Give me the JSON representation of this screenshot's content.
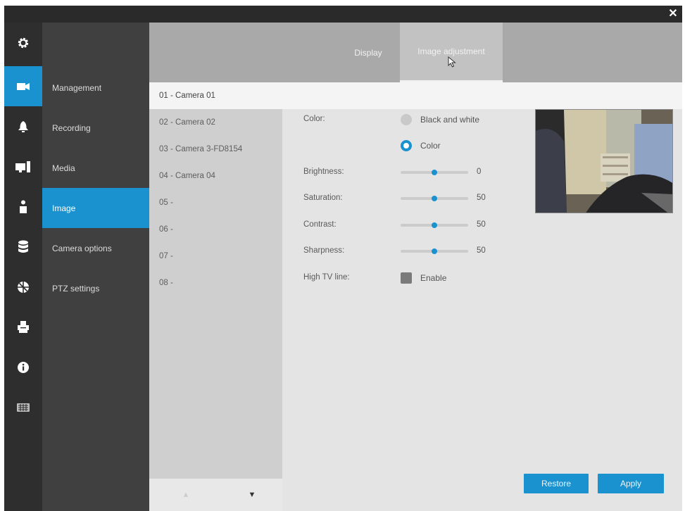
{
  "window": {
    "close_label": "✕"
  },
  "icon_sidebar": [
    {
      "icon": "gear-icon",
      "active": false
    },
    {
      "icon": "camera-icon",
      "active": true
    },
    {
      "icon": "bell-icon",
      "active": false
    },
    {
      "icon": "monitor-icon",
      "active": false
    },
    {
      "icon": "user-icon",
      "active": false
    },
    {
      "icon": "database-icon",
      "active": false
    },
    {
      "icon": "network-icon",
      "active": false
    },
    {
      "icon": "printer-icon",
      "active": false
    },
    {
      "icon": "info-icon",
      "active": false
    },
    {
      "icon": "keyboard-icon",
      "active": false
    }
  ],
  "nav": {
    "items": [
      {
        "label": "Management",
        "active": false
      },
      {
        "label": "Recording",
        "active": false
      },
      {
        "label": "Media",
        "active": false
      },
      {
        "label": "Image",
        "active": true
      },
      {
        "label": "Camera options",
        "active": false
      },
      {
        "label": "PTZ settings",
        "active": false
      }
    ]
  },
  "tabs": [
    {
      "label": "Display",
      "active": false
    },
    {
      "label": "Image adjustment",
      "active": true
    }
  ],
  "cameras": [
    {
      "label": "01 - Camera 01",
      "active": true
    },
    {
      "label": "02 - Camera 02",
      "active": false
    },
    {
      "label": "03 - Camera 3-FD8154",
      "active": false
    },
    {
      "label": "04 - Camera 04",
      "active": false
    },
    {
      "label": "05 -",
      "active": false
    },
    {
      "label": "06 -",
      "active": false
    },
    {
      "label": "07 -",
      "active": false
    },
    {
      "label": "08 -",
      "active": false
    }
  ],
  "pager": {
    "prev": "▲",
    "next": "▼"
  },
  "settings": {
    "color_label": "Color:",
    "color_options": [
      {
        "label": "Black and white",
        "selected": false
      },
      {
        "label": "Color",
        "selected": true
      }
    ],
    "sliders": [
      {
        "label": "Brightness:",
        "value": 0,
        "min": -5,
        "max": 5,
        "display": "0"
      },
      {
        "label": "Saturation:",
        "value": 50,
        "min": 0,
        "max": 100,
        "display": "50"
      },
      {
        "label": "Contrast:",
        "value": 50,
        "min": 0,
        "max": 100,
        "display": "50"
      },
      {
        "label": "Sharpness:",
        "value": 50,
        "min": 0,
        "max": 100,
        "display": "50"
      }
    ],
    "high_tv_line": {
      "label": "High TV line:",
      "option": "Enable",
      "checked": false
    }
  },
  "buttons": {
    "restore": "Restore",
    "apply": "Apply"
  },
  "colors": {
    "accent": "#1a92cf",
    "sidebar_dark": "#2e2e2e",
    "nav_bg": "#404040"
  }
}
